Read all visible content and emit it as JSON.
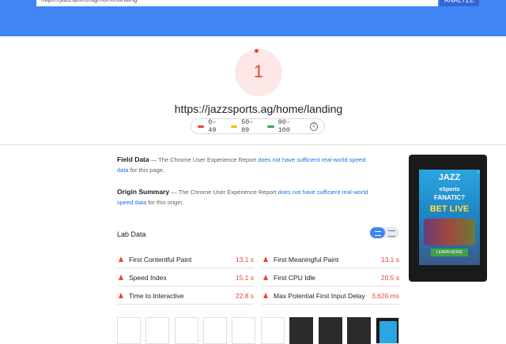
{
  "header": {
    "url_value": "https://jazzsports.ag/home/landing",
    "analyze_label": "ANALYZE",
    "color": "#4285f4"
  },
  "summary": {
    "score": "1",
    "score_color": "#ea4335",
    "url": "https://jazzsports.ag/home/landing"
  },
  "legend": [
    {
      "label": "0–49",
      "color": "#ea4335"
    },
    {
      "label": "50–89",
      "color": "#fbbc04"
    },
    {
      "label": "90–100",
      "color": "#34a853"
    }
  ],
  "field_data": {
    "title": "Field Data",
    "prefix": " — The Chrome User Experience Report ",
    "link": "does not have sufficient real-world speed data",
    "suffix": " for this page."
  },
  "origin_summary": {
    "title": "Origin Summary",
    "prefix": " — The Chrome User Experience Report ",
    "link": "does not have sufficient real-world speed data",
    "suffix": " for this origin."
  },
  "lab_data": {
    "title": "Lab Data",
    "metrics": [
      {
        "label": "First Contentful Paint",
        "value": "13.1 s"
      },
      {
        "label": "First Meaningful Paint",
        "value": "13.1 s"
      },
      {
        "label": "Speed Index",
        "value": "15.1 s"
      },
      {
        "label": "First CPU Idle",
        "value": "20.5 s"
      },
      {
        "label": "Time to Interactive",
        "value": "22.8 s"
      },
      {
        "label": "Max Potential First Input Delay",
        "value": "3,620 ms"
      }
    ]
  },
  "ad_preview": {
    "brand": "JAZZ",
    "line1": "eSports",
    "line2": "FANATIC?",
    "cta": "BET LIVE",
    "button": "LEARN MORE"
  },
  "filmstrip": [
    "blank",
    "blank",
    "blank",
    "blank",
    "blank",
    "blank",
    "dark",
    "dark",
    "dark",
    "phone"
  ]
}
